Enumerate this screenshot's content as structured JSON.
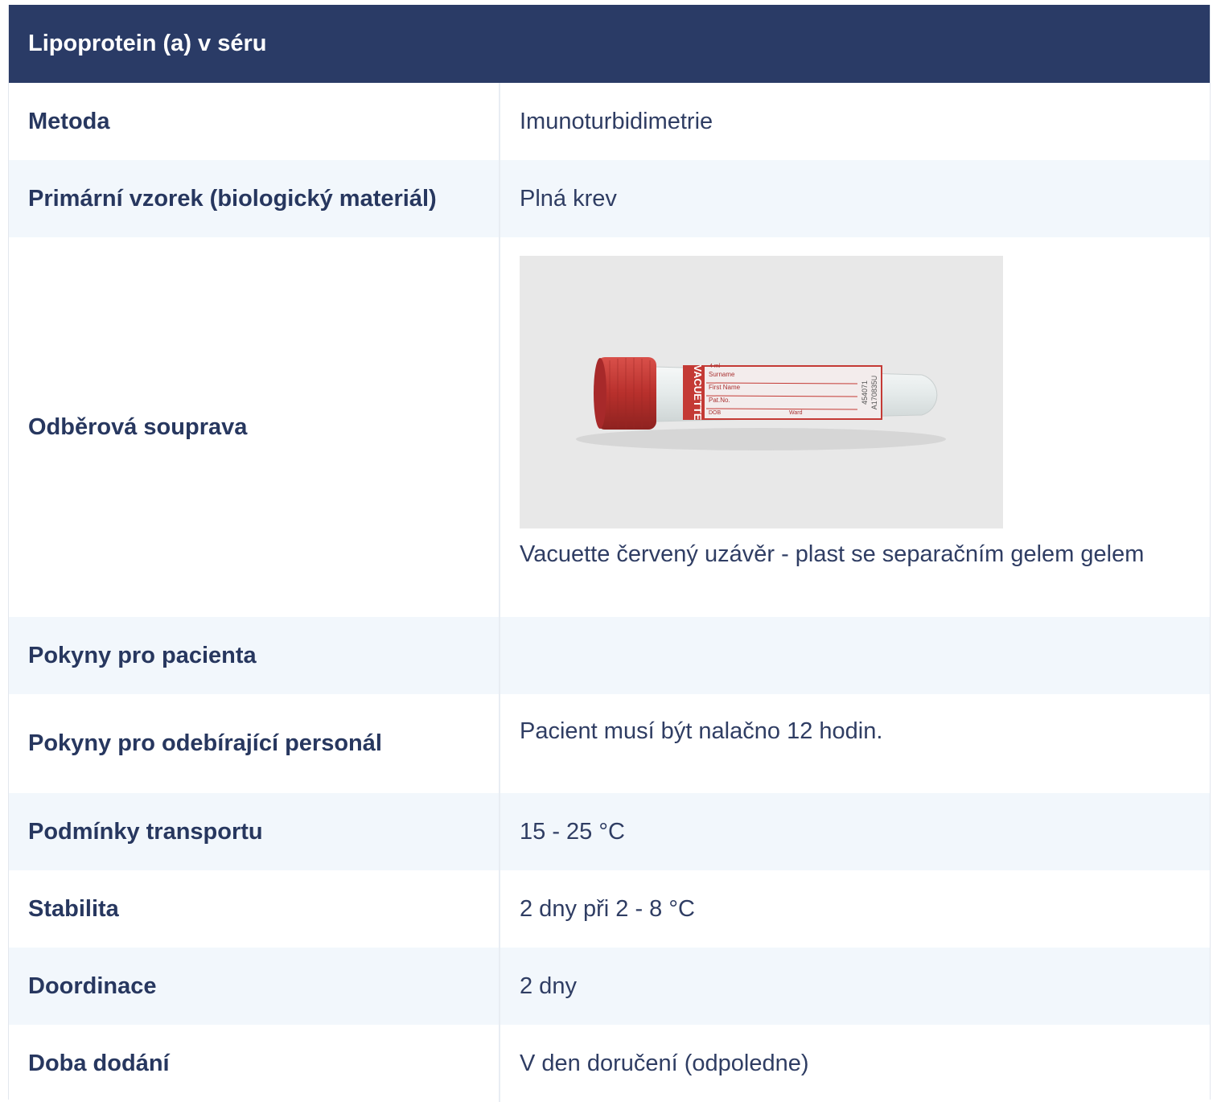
{
  "table": {
    "title": "Lipoprotein (a) v séru",
    "rows": [
      {
        "label": "Metoda",
        "value": "Imunoturbidimetrie"
      },
      {
        "label": "Primární vzorek (biologický materiál)",
        "value": "Plná krev"
      },
      {
        "label": "Odběrová souprava",
        "value": "Vacuette červený uzávěr - plast se separačním gelem gelem"
      },
      {
        "label": "Pokyny pro pacienta",
        "value": ""
      },
      {
        "label": "Pokyny pro odebírající personál",
        "value": "Pacient musí být nalačno 12 hodin."
      },
      {
        "label": "Podmínky transportu",
        "value": "15 - 25 °C"
      },
      {
        "label": "Stabilita",
        "value": "2 dny při 2 - 8 °C"
      },
      {
        "label": "Doordinace",
        "value": "2 dny"
      },
      {
        "label": "Doba dodání",
        "value": "V den doručení (odpoledne)"
      }
    ]
  },
  "tube_label": {
    "brand": "VACUETTE",
    "volume": "4 ml",
    "fields": [
      "Surname",
      "First Name",
      "Pat.No.",
      "DOB",
      "Ward"
    ],
    "codes": [
      "454071",
      "A170835U"
    ]
  },
  "colors": {
    "header_bg": "#2a3b66",
    "alt_row_bg": "#f2f7fc",
    "text": "#27375f",
    "cap_red": "#c0342f"
  }
}
